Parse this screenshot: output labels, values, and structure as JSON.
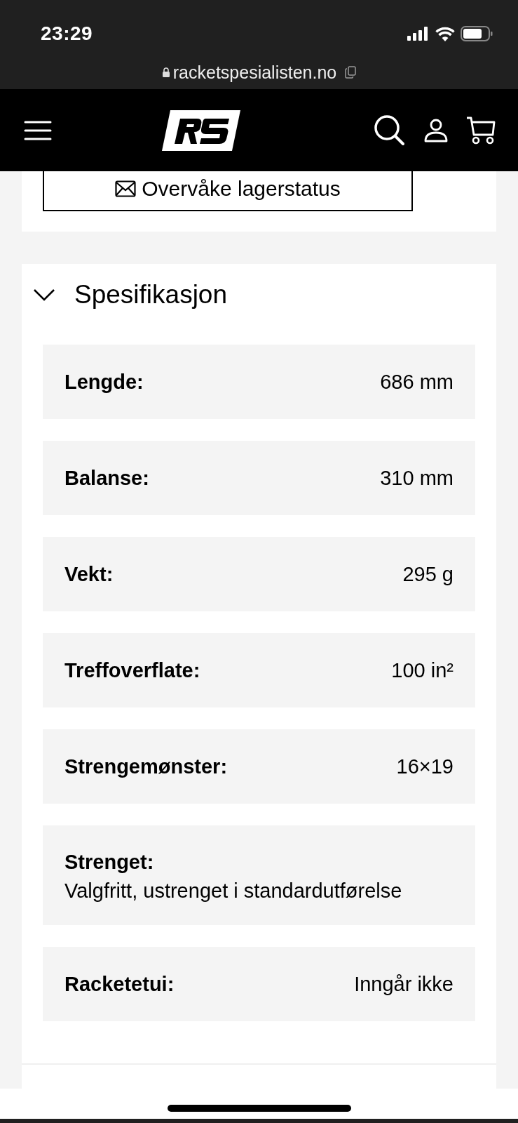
{
  "status_bar": {
    "time": "23:29"
  },
  "address_bar": {
    "url": "racketspesialisten.no"
  },
  "stock_button": {
    "label": "Overvåke lagerstatus"
  },
  "spec_section": {
    "title": "Spesifikasjon",
    "expanded": true,
    "rows": [
      {
        "kind": "inline",
        "label": "Lengde:",
        "value": "686 mm"
      },
      {
        "kind": "inline",
        "label": "Balanse:",
        "value": "310 mm"
      },
      {
        "kind": "inline",
        "label": "Vekt:",
        "value": "295 g"
      },
      {
        "kind": "inline",
        "label": "Treffoverflate:",
        "value": "100 in²"
      },
      {
        "kind": "inline",
        "label": "Strengemønster:",
        "value": "16×19"
      },
      {
        "kind": "stacked",
        "label": "Strenget:",
        "value": "Valgfritt, ustrenget i standardutførelse"
      },
      {
        "kind": "inline",
        "label": "Racketetui:",
        "value": "Inngår ikke"
      }
    ]
  }
}
